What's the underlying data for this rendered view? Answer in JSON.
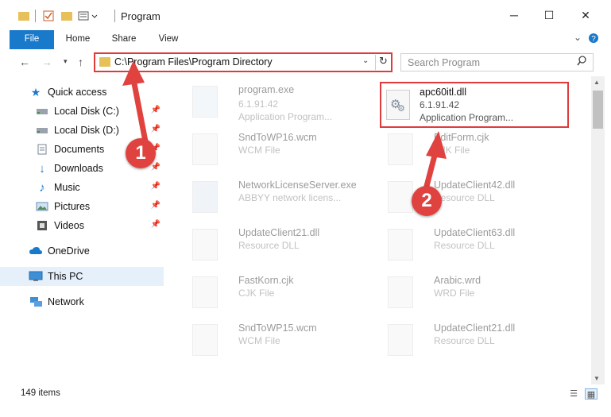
{
  "window": {
    "title": "Program",
    "controls": {
      "minimize": "─",
      "maximize": "☐",
      "close": "✕"
    }
  },
  "ribbon": {
    "tabs": [
      "File",
      "Home",
      "Share",
      "View"
    ],
    "expand_icon": "chevron-down-icon",
    "help_icon": "help-icon"
  },
  "address": {
    "path": "C:\\Program Files\\Program Directory",
    "refresh_icon": "refresh-icon"
  },
  "search": {
    "placeholder": "Search Program"
  },
  "nav": {
    "quick_access": "Quick access",
    "pinned": [
      {
        "label": "Local Disk (C:)",
        "icon": "drive-icon"
      },
      {
        "label": "Local Disk (D:)",
        "icon": "drive-icon"
      },
      {
        "label": "Documents",
        "icon": "documents-icon"
      },
      {
        "label": "Downloads",
        "icon": "downloads-icon"
      },
      {
        "label": "Music",
        "icon": "music-icon"
      },
      {
        "label": "Pictures",
        "icon": "pictures-icon"
      },
      {
        "label": "Videos",
        "icon": "videos-icon"
      }
    ],
    "onedrive": "OneDrive",
    "thispc": "This PC",
    "network": "Network"
  },
  "files": [
    {
      "name": "program.exe",
      "line2": "6.1.91.42",
      "line3": "Application Program..."
    },
    {
      "name": "apc60itl.dll",
      "line2": "6.1.91.42",
      "line3": "Application Program..."
    },
    {
      "name": "SndToWP16.wcm",
      "line2": "WCM File"
    },
    {
      "name": "EditForm.cjk",
      "line2": "CJK File"
    },
    {
      "name": "NetworkLicenseServer.exe",
      "line2": "ABBYY network licens..."
    },
    {
      "name": "UpdateClient42.dll",
      "line2": "Resource DLL"
    },
    {
      "name": "UpdateClient21.dll",
      "line2": "Resource DLL"
    },
    {
      "name": "UpdateClient63.dll",
      "line2": "Resource DLL"
    },
    {
      "name": "FastKorn.cjk",
      "line2": "CJK File"
    },
    {
      "name": "Arabic.wrd",
      "line2": "WRD File"
    },
    {
      "name": "SndToWP15.wcm",
      "line2": "WCM File"
    },
    {
      "name": "UpdateClient21.dll",
      "line2": "Resource DLL"
    }
  ],
  "status": {
    "items": "149 items"
  },
  "annotations": {
    "marker1": "1",
    "marker2": "2"
  },
  "colors": {
    "accent": "#1979ca",
    "highlight": "#e03a3a",
    "marker": "#e0433f"
  }
}
